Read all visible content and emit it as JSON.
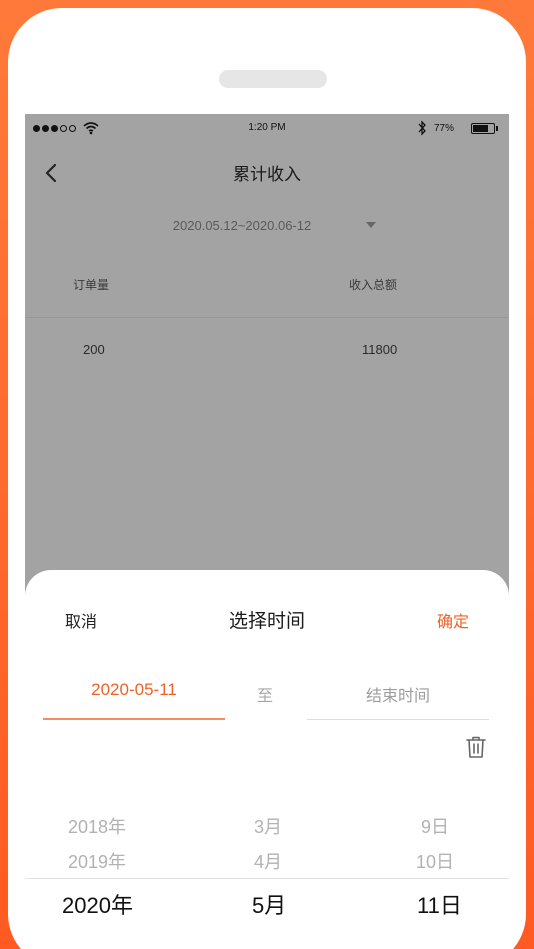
{
  "status_bar": {
    "time": "1:20 PM",
    "battery_percent": "77%",
    "battery_level": 0.77,
    "signal_bars": 5,
    "signal_filled": 3
  },
  "nav": {
    "back_icon": "chevron-left-icon",
    "title": "累计收入"
  },
  "filter": {
    "date_range": "2020.05.12~2020.06-12",
    "dropdown_icon": "caret-down-icon"
  },
  "summary": {
    "headers": [
      "订单量",
      "收入总额"
    ],
    "values": [
      "200",
      "11800"
    ]
  },
  "date_picker": {
    "cancel_label": "取消",
    "title": "选择时间",
    "confirm_label": "确定",
    "start_date": "2020-05-11",
    "separator": "至",
    "end_placeholder": "结束时间",
    "clear_icon": "trash-icon",
    "years": [
      "2018年",
      "2019年",
      "2020年"
    ],
    "months": [
      "3月",
      "4月",
      "5月"
    ],
    "days": [
      "9日",
      "10日",
      "11日"
    ],
    "selected": {
      "year": "2020年",
      "month": "5月",
      "day": "11日"
    }
  },
  "colors": {
    "accent": "#ef6227",
    "background_orange": "#ff6a2e",
    "overlay_gray": "#a3a3a3"
  }
}
